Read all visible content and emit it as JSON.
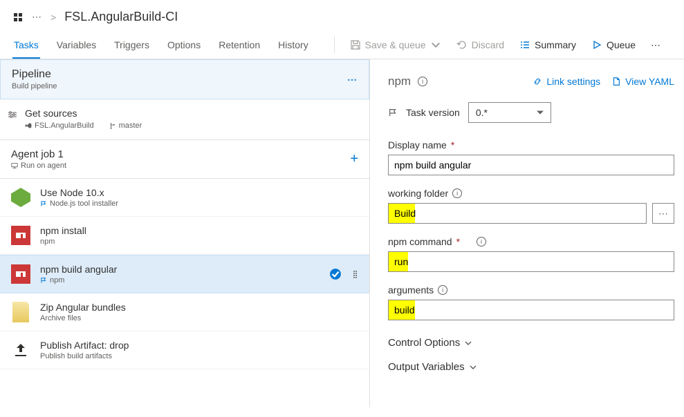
{
  "breadcrumb": {
    "title": "FSL.AngularBuild-CI"
  },
  "tabs": [
    "Tasks",
    "Variables",
    "Triggers",
    "Options",
    "Retention",
    "History"
  ],
  "toolbar": {
    "saveQueue": "Save & queue",
    "discard": "Discard",
    "summary": "Summary",
    "queue": "Queue"
  },
  "pipeline": {
    "title": "Pipeline",
    "subtitle": "Build pipeline"
  },
  "getSources": {
    "title": "Get sources",
    "repo": "FSL.AngularBuild",
    "branch": "master"
  },
  "job": {
    "title": "Agent job 1",
    "subtitle": "Run on agent"
  },
  "tasks": [
    {
      "title": "Use Node 10.x",
      "sub": "Node.js tool installer",
      "icon": "node",
      "flag": true
    },
    {
      "title": "npm install",
      "sub": "npm",
      "icon": "npm",
      "flag": false
    },
    {
      "title": "npm build angular",
      "sub": "npm",
      "icon": "npm",
      "flag": true,
      "selected": true
    },
    {
      "title": "Zip Angular bundles",
      "sub": "Archive files",
      "icon": "zip",
      "flag": false
    },
    {
      "title": "Publish Artifact: drop",
      "sub": "Publish build artifacts",
      "icon": "publish",
      "flag": false
    }
  ],
  "detail": {
    "title": "npm",
    "links": {
      "link": "Link settings",
      "yaml": "View YAML"
    },
    "versionLabel": "Task version",
    "version": "0.*",
    "fields": {
      "displayName": {
        "label": "Display name",
        "value": "npm build angular",
        "required": true
      },
      "workingFolder": {
        "label": "working folder",
        "value": "Build"
      },
      "npmCommand": {
        "label": "npm command",
        "value": "run",
        "required": true
      },
      "arguments": {
        "label": "arguments",
        "value": "build"
      }
    },
    "sections": {
      "control": "Control Options",
      "output": "Output Variables"
    }
  }
}
